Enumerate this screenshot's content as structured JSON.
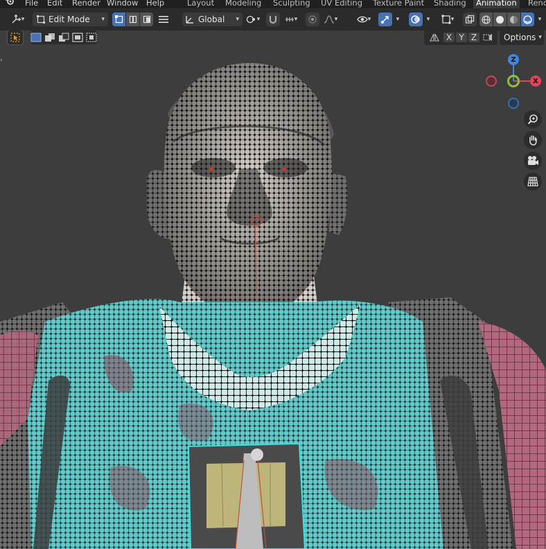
{
  "menu": {
    "file": "File",
    "edit": "Edit",
    "render": "Render",
    "window": "Window",
    "help": "Help"
  },
  "workspaces": [
    "Layout",
    "Modeling",
    "Sculpting",
    "UV Editing",
    "Texture Paint",
    "Shading",
    "Animation",
    "Rend"
  ],
  "active_workspace": "Animation",
  "header": {
    "mode": "Edit Mode",
    "transform_orientation": "Global",
    "options": "Options"
  },
  "axes_toggles": [
    "X",
    "Y",
    "Z"
  ],
  "gizmo": {
    "z": "Z",
    "y": "Y",
    "x": "X"
  },
  "colors": {
    "accent_blue": "#4772b3",
    "axis_x": "#e0465b",
    "axis_y": "#8ac23c",
    "axis_z": "#3d88e0",
    "mesh_cyan": "#5fd2d0",
    "mesh_pink": "#c46a86",
    "skin": "#d8d2cc",
    "box_yellow": "#c6bd7c"
  },
  "icons": {
    "blender": "blender-logo-icon",
    "transform": "transform-pivot-icon",
    "vertex_select": "vertex-select-icon",
    "edge_select": "edge-select-icon",
    "face_select": "face-select-icon",
    "menu": "hamburger-icon",
    "snap": "magnet-icon",
    "proportional": "proportional-edit-icon",
    "overlay": "overlay-icon",
    "xray": "xray-icon",
    "zoom": "zoom-icon",
    "pan": "hand-icon",
    "camera": "camera-icon",
    "ortho": "grid-icon"
  }
}
